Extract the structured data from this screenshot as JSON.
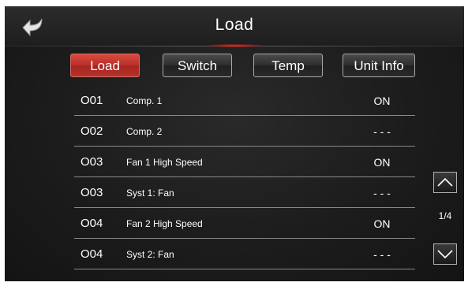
{
  "header": {
    "title": "Load",
    "accent_color": "#e0332a"
  },
  "tabs": [
    {
      "label": "Load",
      "active": true
    },
    {
      "label": "Switch",
      "active": false
    },
    {
      "label": "Temp",
      "active": false
    },
    {
      "label": "Unit Info",
      "active": false
    }
  ],
  "rows": [
    {
      "code": "O01",
      "name": "Comp. 1",
      "status": "ON"
    },
    {
      "code": "O02",
      "name": "Comp. 2",
      "status": "- - -"
    },
    {
      "code": "O03",
      "name": "Fan 1 High Speed",
      "status": "ON"
    },
    {
      "code": "O03",
      "name": "Syst 1: Fan",
      "status": "- - -"
    },
    {
      "code": "O04",
      "name": "Fan 2 High Speed",
      "status": "ON"
    },
    {
      "code": "O04",
      "name": "Syst 2: Fan",
      "status": "- - -"
    }
  ],
  "pagination": {
    "indicator": "1/4",
    "up_icon": "chevron-up-icon",
    "down_icon": "chevron-down-icon"
  },
  "icons": {
    "back": "back-arrow-icon"
  }
}
